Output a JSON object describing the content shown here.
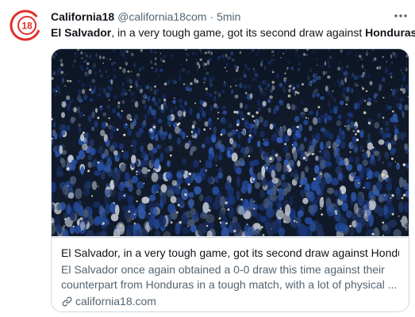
{
  "tweet": {
    "author": {
      "name": "California18",
      "handle": "@california18com",
      "time": "5min",
      "avatar_text": "18",
      "avatar_color": "#e0302a"
    },
    "more_icon": "more-horizontal-icon",
    "text": {
      "part1": "El Salvador",
      "part2": ", in a very tough game, got its second draw against ",
      "part3": "Honduras"
    },
    "card": {
      "image_alt": "Stadium crowd at night with phone lights",
      "title": "El Salvador, in a very tough game, got its second draw against Hondur...",
      "description_line1": "El Salvador once again obtained a 0-0 draw this time against their",
      "description_line2": "counterpart from Honduras in a tough match, with a lot of physical ...",
      "domain": "california18.com",
      "link_icon": "link-icon"
    }
  },
  "colors": {
    "text": "#0f1419",
    "secondary": "#536471",
    "border": "#cfd9de",
    "crowd_blue": "#1f4fa8"
  }
}
